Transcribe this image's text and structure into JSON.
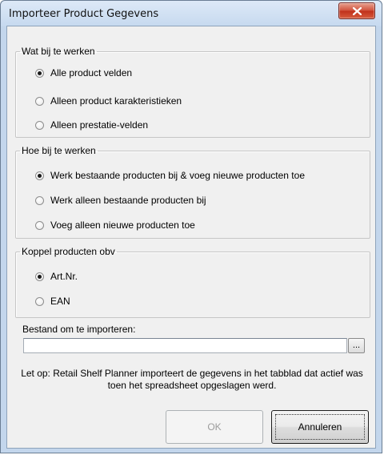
{
  "window": {
    "title": "Importeer Product Gegevens"
  },
  "group_update_what": {
    "legend": "Wat bij te werken",
    "options": [
      {
        "label": "Alle product velden",
        "checked": true
      },
      {
        "label": "Alleen product karakteristieken",
        "checked": false
      },
      {
        "label": "Alleen prestatie-velden",
        "checked": false
      }
    ]
  },
  "group_update_how": {
    "legend": "Hoe bij te werken",
    "options": [
      {
        "label": "Werk bestaande producten bij & voeg nieuwe producten toe",
        "checked": true
      },
      {
        "label": "Werk alleen bestaande producten bij",
        "checked": false
      },
      {
        "label": "Voeg alleen nieuwe producten toe",
        "checked": false
      }
    ]
  },
  "group_link": {
    "legend": "Koppel producten obv",
    "options": [
      {
        "label": "Art.Nr.",
        "checked": true
      },
      {
        "label": "EAN",
        "checked": false
      }
    ]
  },
  "file": {
    "label": "Bestand om te importeren:",
    "value": "",
    "browse_label": "..."
  },
  "note": "Let op: Retail Shelf Planner importeert de gegevens in het tabblad dat actief was toen het spreadsheet opgeslagen werd.",
  "buttons": {
    "ok_label": "OK",
    "ok_enabled": false,
    "cancel_label": "Annuleren"
  },
  "icons": {
    "close": "close-icon"
  },
  "colors": {
    "close_button": "#c7402a",
    "dialog_background": "#f0f0f0",
    "frame": "#c3d6ec"
  }
}
